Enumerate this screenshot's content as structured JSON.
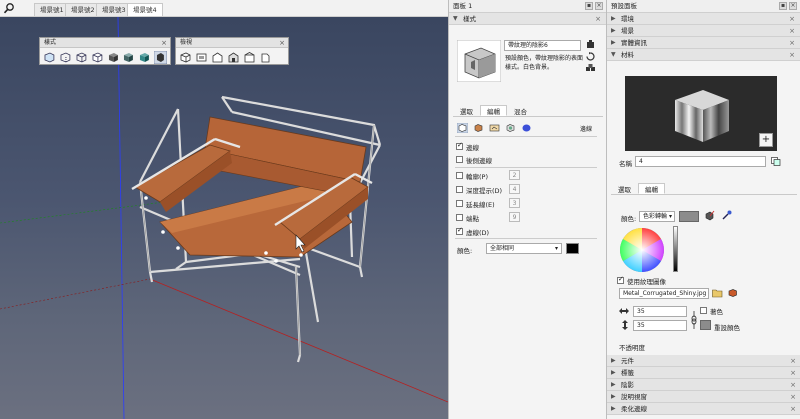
{
  "tabs": [
    "場景號1",
    "場景號2",
    "場景號3",
    "場景號4"
  ],
  "toolbars": {
    "style_title": "樣式",
    "view_title": "檢視"
  },
  "tray1": {
    "title": "面板 1",
    "styles_section": "樣式",
    "style_name": "帶紋理的陰影6",
    "style_desc": "預設顏色，帶紋理陰影的表面樣式。白色背景。",
    "tabs": [
      "選取",
      "編輯",
      "混合"
    ],
    "edit_mode_label": "邊線",
    "options": [
      {
        "label": "邊線",
        "checked": true
      },
      {
        "label": "後側邊線",
        "checked": false
      },
      {
        "label": "輪廓(P)",
        "checked": false,
        "value": "2"
      },
      {
        "label": "深度提示(D)",
        "checked": false,
        "value": "4"
      },
      {
        "label": "延長線(E)",
        "checked": false,
        "value": "3"
      },
      {
        "label": "端點",
        "checked": false,
        "value": "9"
      },
      {
        "label": "虛線(D)",
        "checked": true
      }
    ],
    "color_label": "顏色:",
    "color_value": "全部相同"
  },
  "tray2": {
    "title": "預設面板",
    "sections_top": [
      "環境",
      "場景",
      "實體資訊",
      "材料"
    ],
    "name_label": "名稱",
    "name_value": "4",
    "tabs": [
      "選取",
      "編輯"
    ],
    "color_label": "顏色:",
    "color_mode": "色彩轉輪",
    "use_texture_label": "使用紋理圖像",
    "texture_file": "Metal_Corrugated_Shiny.jpg",
    "width_value": "35",
    "height_value": "35",
    "colorize_label": "著色",
    "reset_color_label": "重設顏色",
    "opacity_label": "不透明度",
    "sections_bottom": [
      "元件",
      "標籤",
      "陰影",
      "說明視窗",
      "柔化邊線"
    ]
  }
}
